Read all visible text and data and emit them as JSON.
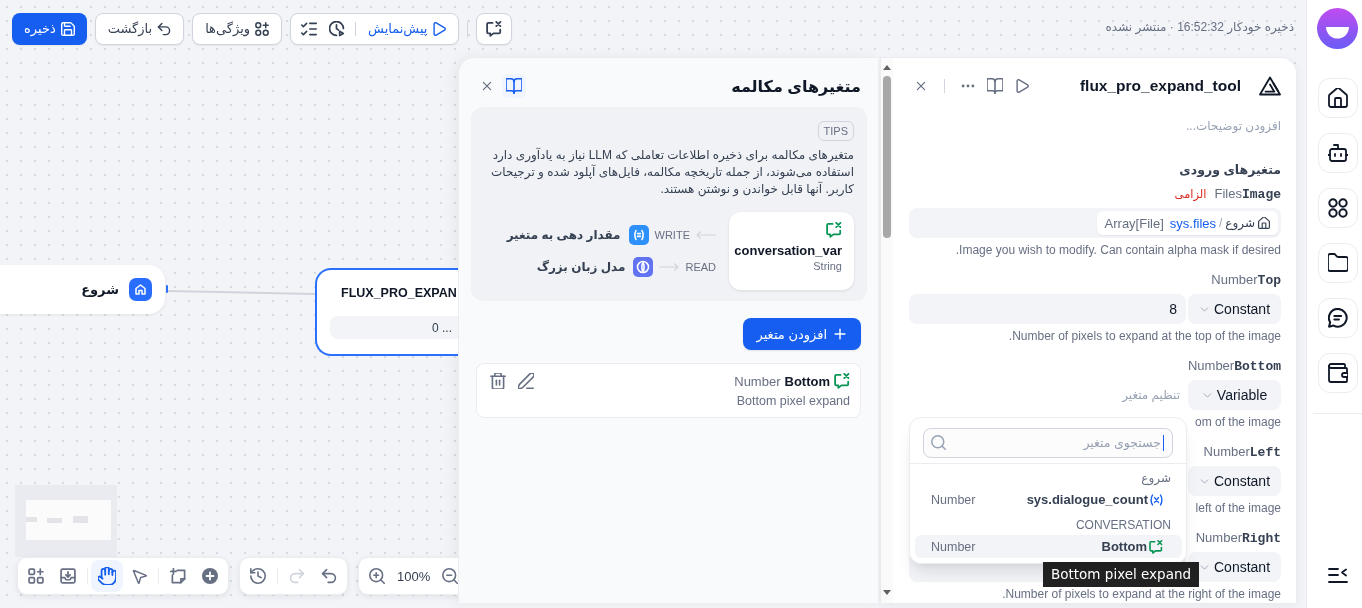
{
  "top_bar": {
    "status": "ذخیره خودکار 16:52:32 · منتشر نشده",
    "preview": "پیش‌نمایش",
    "features": "ویژگی‌ها",
    "back": "بازگشت",
    "save": "ذخیره"
  },
  "canvas": {
    "nodes": [
      {
        "kind": "tool",
        "title": "FLUX_PRO_EXPAN",
        "field": "0 ...",
        "selected": true
      },
      {
        "kind": "start",
        "title": "شروع",
        "selected": false
      }
    ],
    "toolbar": {
      "tools": [
        {
          "kind": "add-block",
          "selected": false
        },
        {
          "kind": "import",
          "selected": false
        },
        {
          "kind": "hand",
          "selected": true
        },
        {
          "kind": "pointer",
          "selected": false
        },
        {
          "kind": "note",
          "selected": false
        },
        {
          "kind": "add",
          "selected": false
        }
      ],
      "history": [
        {
          "kind": "history",
          "disabled": false
        },
        {
          "kind": "redo",
          "disabled": true
        },
        {
          "kind": "undo",
          "disabled": false
        }
      ],
      "zoom": "100%"
    }
  },
  "conversation_panel": {
    "title": "متغیرهای مکالمه",
    "tips": {
      "badge": "TIPS",
      "text": "متغیرهای مکالمه برای ذخیره اطلاعات تعاملی که LLM نیاز به یادآوری دارد استفاده می‌شوند، از جمله تاریخچه مکالمه، فایل‌های آپلود شده و ترجیحات کاربر. آنها قابل خواندن و نوشتن هستند.",
      "variable": {
        "name": "conversation_var",
        "type": "String"
      },
      "flows": [
        {
          "kind": "write",
          "label": "WRITE",
          "target": "مقدار دهی به متغیر"
        },
        {
          "kind": "read",
          "label": "READ",
          "target": "مدل زبان بزرگ"
        }
      ]
    },
    "add_button": "افزودن متغیر",
    "variables": [
      {
        "name": "Bottom",
        "type": "Number",
        "description": "Bottom pixel expand"
      }
    ]
  },
  "node_panel": {
    "title": "flux_pro_expand_tool",
    "description_placeholder": "افزودن توضیحات...",
    "section": "متغیرهای ورودی",
    "fields": [
      {
        "kind": "variable-ref",
        "name": "Image",
        "type": "Files",
        "required": "الزامی",
        "ref": {
          "node": "شروع",
          "separator": "/",
          "variable": "sys.files",
          "type": "Array[File]"
        },
        "description": "Image you wish to modify. Can contain alpha mask if desired."
      },
      {
        "kind": "constant",
        "name": "Top",
        "type": "Number",
        "mode": "Constant",
        "value": "8",
        "description": "Number of pixels to expand at the top of the image."
      },
      {
        "kind": "variable",
        "name": "Bottom",
        "type": "Number",
        "mode": "Variable",
        "placeholder": "تنظیم متغیر",
        "description": "om of the image"
      },
      {
        "kind": "constant",
        "name": "Left",
        "type": "Number",
        "mode": "Constant",
        "description": "left of the image"
      },
      {
        "kind": "constant",
        "name": "Right",
        "type": "Number",
        "mode": "Constant",
        "description": "Number of pixels to expand at the right of the image."
      }
    ],
    "variable_picker": {
      "search_placeholder": "جستجوی متغیر",
      "focused": true,
      "groups": [
        {
          "title": "شروع",
          "items": [
            {
              "kind": "system",
              "name": "sys.dialogue_count",
              "type": "Number",
              "selected": false
            }
          ]
        },
        {
          "title": "CONVERSATION",
          "items": [
            {
              "kind": "conversation",
              "name": "Bottom",
              "type": "Number",
              "selected": true
            }
          ]
        }
      ]
    },
    "tooltip": "Bottom pixel expand"
  }
}
